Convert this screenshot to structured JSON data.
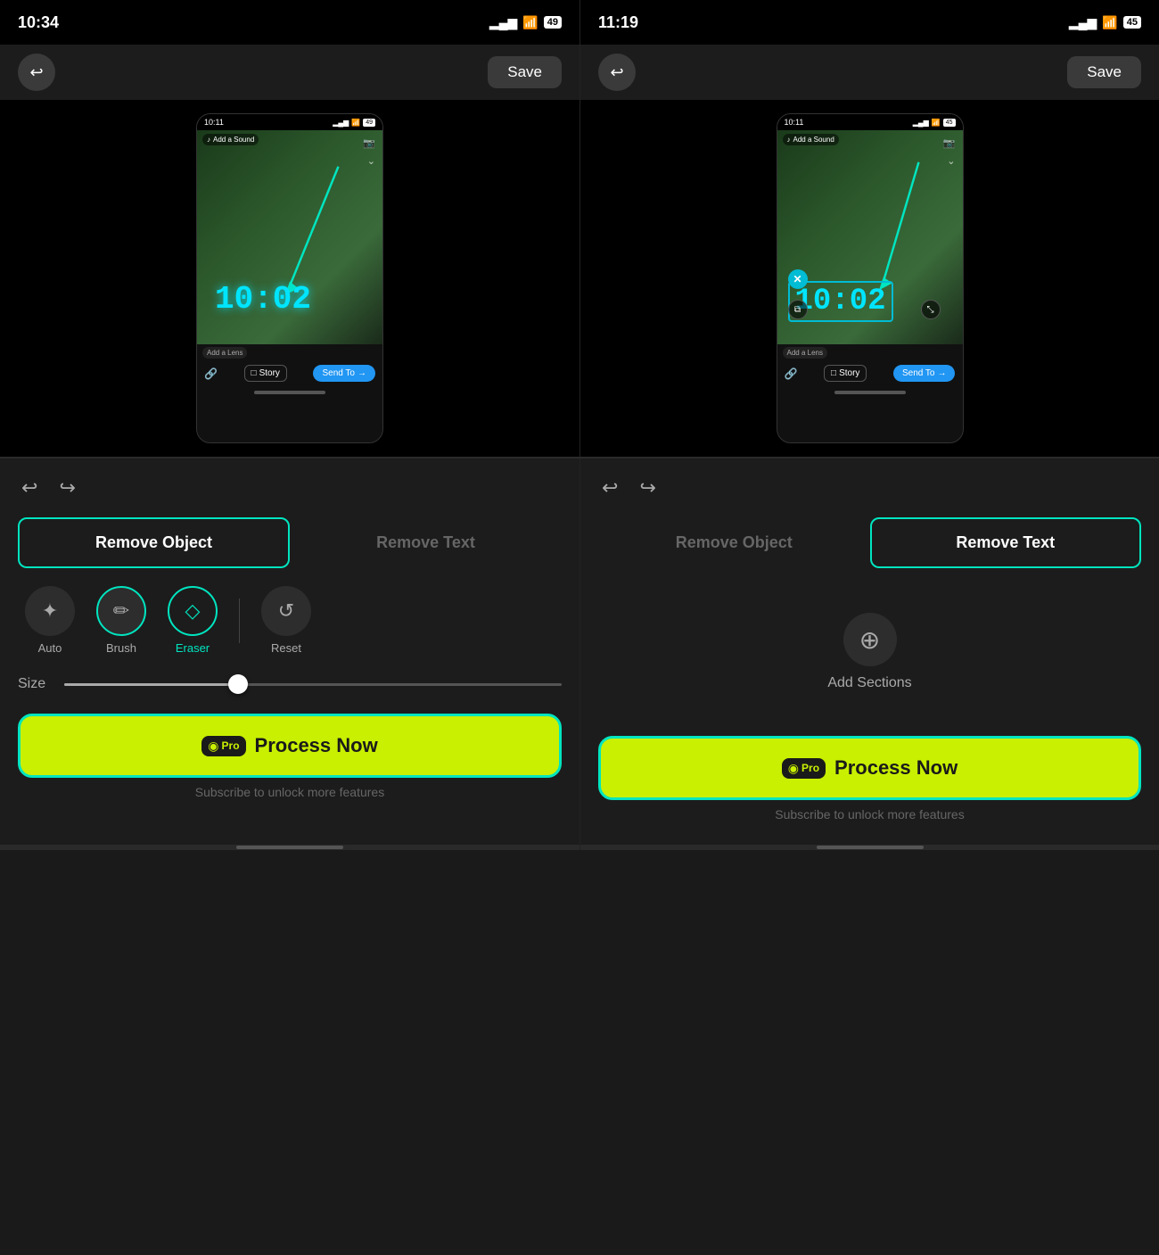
{
  "left_panel": {
    "status_time": "10:34",
    "battery": "49",
    "back_label": "←",
    "save_label": "Save",
    "phone_time": "10:11",
    "clock_display": "10:02",
    "sound_label": "Add a Sound",
    "lens_label": "Add a Lens",
    "story_label": "Story",
    "send_label": "Send To",
    "undo_label": "↩",
    "redo_label": "↪",
    "tab_remove_object": "Remove Object",
    "tab_remove_text": "Remove Text",
    "tool_auto": "Auto",
    "tool_brush": "Brush",
    "tool_eraser": "Eraser",
    "tool_reset": "Reset",
    "size_label": "Size",
    "slider_percent": 35,
    "process_label": "Process Now",
    "pro_label": "Pro",
    "subscribe_label": "Subscribe to unlock more features",
    "active_tab": "remove_object"
  },
  "right_panel": {
    "status_time": "11:19",
    "battery": "45",
    "back_label": "←",
    "save_label": "Save",
    "phone_time": "10:11",
    "clock_display": "10:02",
    "sound_label": "Add a Sound",
    "lens_label": "Add a Lens",
    "story_label": "Story",
    "send_label": "Send To",
    "undo_label": "↩",
    "redo_label": "↪",
    "tab_remove_object": "Remove Object",
    "tab_remove_text": "Remove Text",
    "add_sections_label": "Add Sections",
    "process_label": "Process Now",
    "pro_label": "Pro",
    "subscribe_label": "Subscribe to unlock more features",
    "active_tab": "remove_text"
  },
  "icons": {
    "back": "↩",
    "undo": "↩",
    "redo": "↪",
    "auto": "✦",
    "brush": "✏",
    "eraser": "◇",
    "reset": "↺",
    "add_sections": "⊕",
    "pro": "◉",
    "story": "□",
    "send": "→",
    "link": "🔗",
    "music": "♪",
    "camera": "📷",
    "close": "✕",
    "copy": "⧉",
    "resize": "⤡"
  }
}
